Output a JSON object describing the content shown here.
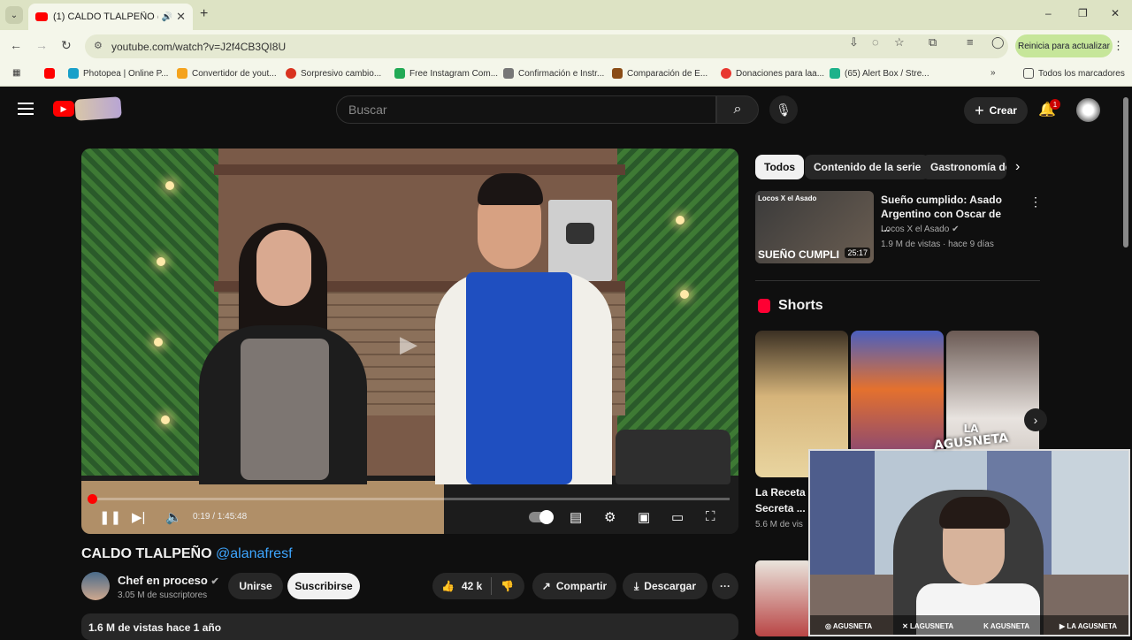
{
  "browser": {
    "tab_title": "(1) CALDO TLALPEÑO @ala",
    "new_tab": "+",
    "url": "youtube.com/watch?v=J2f4CB3QI8U",
    "update_label": "Reinicia para actualizar",
    "window_controls": [
      "–",
      "❐",
      "✕"
    ],
    "nav": [
      "←",
      "→",
      "↻"
    ],
    "bookmarks": [
      {
        "label": "Photopea | Online P...",
        "color": "#19a0c9"
      },
      {
        "label": "Convertidor de yout...",
        "color": "#f4a31d"
      },
      {
        "label": "Sorpresivo cambio...",
        "color": "#d9331f"
      },
      {
        "label": "Free Instagram Com...",
        "color": "#22aa55"
      },
      {
        "label": "Confirmación e Instr...",
        "color": "#777777"
      },
      {
        "label": "Comparación de E...",
        "color": "#8a4c16"
      },
      {
        "label": "Donaciones para laa...",
        "color": "#e8372f"
      },
      {
        "label": "(65) Alert Box / Stre...",
        "color": "#1db28a"
      }
    ],
    "more_bookmarks": "»",
    "all_bookmarks": "Todos los marcadores"
  },
  "youtube": {
    "search_placeholder": "Buscar",
    "create_label": "Crear",
    "notifications_count": "1"
  },
  "player": {
    "time": "0:19 / 1:45:48",
    "progress": 0.003
  },
  "video": {
    "title": "CALDO TLALPEÑO",
    "mention": "@alanaf",
    "mention_tail": "resf",
    "channel": "Chef en proceso",
    "subscribers": "3.05 M de suscriptores",
    "join_label": "Unirse",
    "subscribe_label": "Suscribirse",
    "likes": "42 k",
    "share_label": "Compartir",
    "download_label": "Descargar",
    "views_meta": "1.6 M de vistas  hace 1 año"
  },
  "sidebar": {
    "chips": [
      "Todos",
      "Contenido de la serie",
      "Gastronomía de"
    ],
    "recommended": {
      "title": "Sueño cumplido: Asado Argentino con Oscar de ...",
      "channel": "Locos X el Asado",
      "meta": "1.9 M de vistas · hace 9 días",
      "duration": "25:17",
      "thumb_text": "SUEÑO CUMPLI",
      "thumb_brand": "Locos X el Asado"
    },
    "shorts_heading": "Shorts",
    "short1_title_line1": "La Receta",
    "short1_title_line2": "Secreta ...",
    "short1_views": "5.6 M de vis"
  },
  "overlay": {
    "logo_line1": "LA",
    "logo_line2": "AGUSNETA",
    "socials": [
      "AGUSNETA",
      "LAGUSNETA",
      "AGUSNETA",
      "LA AGUSNETA"
    ]
  }
}
